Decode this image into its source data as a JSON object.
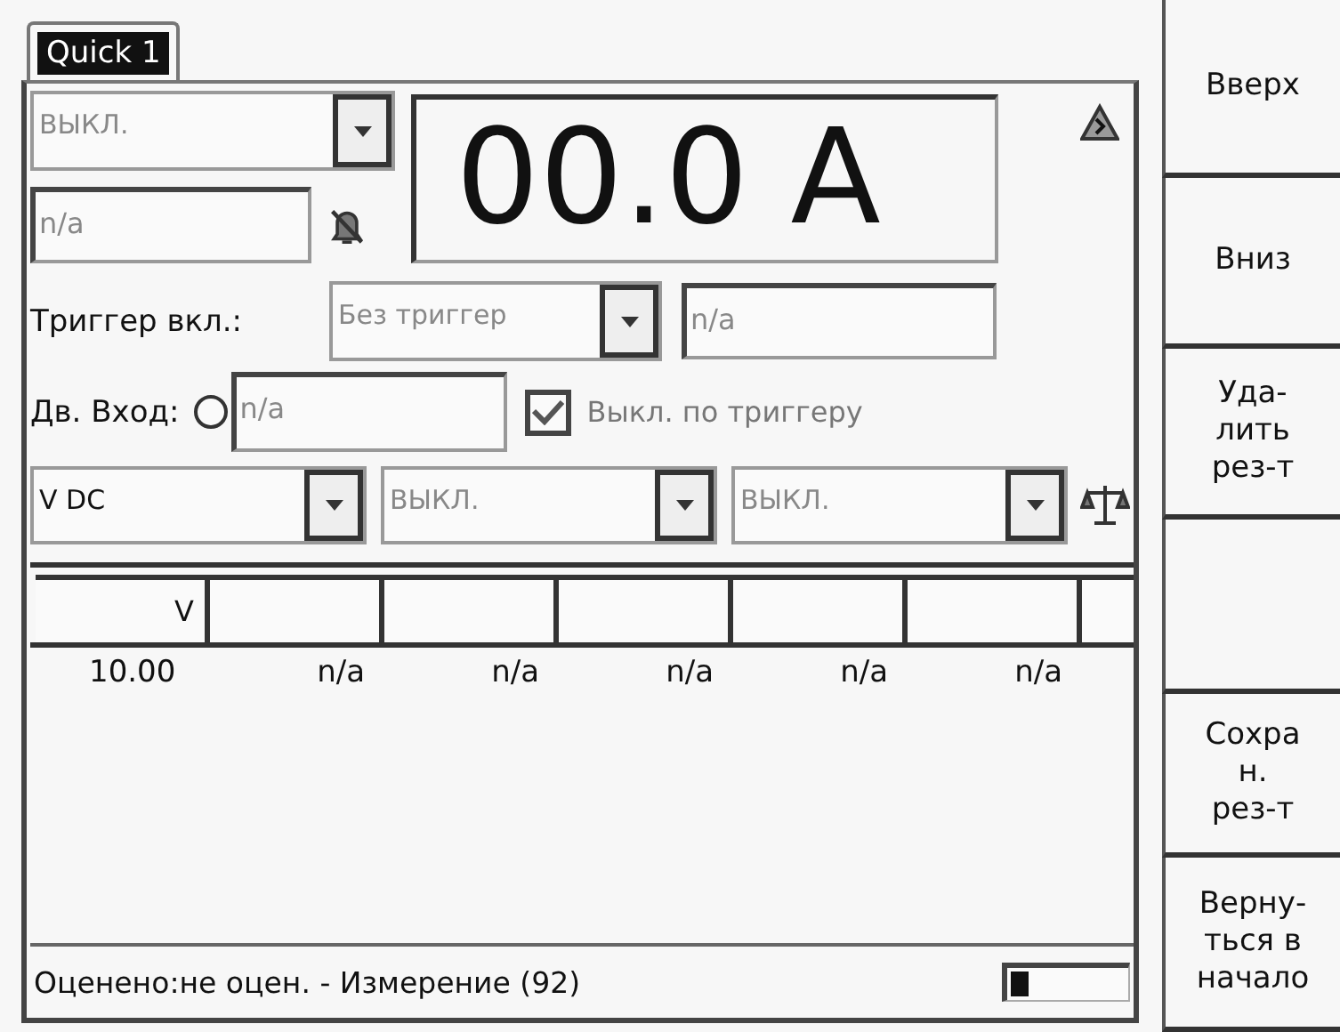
{
  "tab": {
    "label": "Quick 1",
    "selected": true
  },
  "mode_dropdown": {
    "value": "ВЫКЛ.",
    "disabled": true
  },
  "reading_field": {
    "value": "n/a"
  },
  "display": {
    "value": "00.0 A"
  },
  "trigger": {
    "label": "Триггер вкл.:",
    "value": "Без триггер",
    "disabled": true,
    "field": "n/a"
  },
  "dual_input": {
    "label": "Дв. Вход:",
    "selected": false,
    "field": "n/a"
  },
  "trigger_off": {
    "label": "Выкл. по триггеру",
    "checked": true
  },
  "channel_dropdowns": [
    {
      "value": "V DC",
      "disabled": false
    },
    {
      "value": "ВЫКЛ.",
      "disabled": true
    },
    {
      "value": "ВЫКЛ.",
      "disabled": true
    }
  ],
  "table": {
    "columns": [
      "V"
    ],
    "rows": [
      [
        "10.00",
        "n/a",
        "n/a",
        "n/a",
        "n/a",
        "n/a"
      ]
    ]
  },
  "status_bar": {
    "text": "Оценено:не оцен. - Измерение (92)",
    "level": 0.15
  },
  "softkeys": [
    {
      "kind": "label",
      "label": "Вверх"
    },
    {
      "kind": "label",
      "label": "Вниз"
    },
    {
      "kind": "label",
      "label": "Уда-\nлить\nрез-т"
    },
    {
      "kind": "blank"
    },
    {
      "kind": "label",
      "label": "Сохра\nн.\nрез-т"
    },
    {
      "kind": "label",
      "label": "Верну-\nться в\nначало"
    }
  ]
}
